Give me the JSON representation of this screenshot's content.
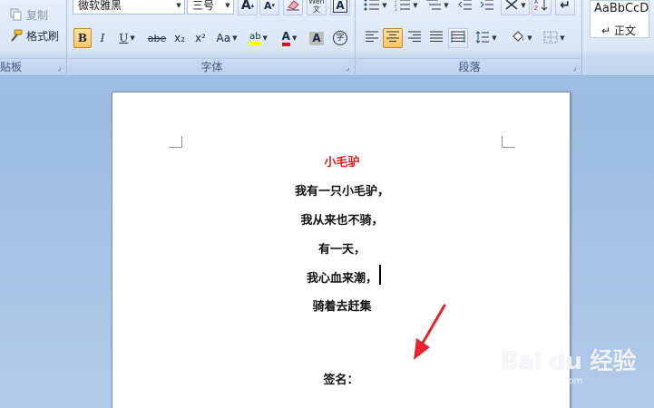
{
  "ribbon": {
    "clipboard": {
      "copy_label": "复制",
      "format_painter_label": "格式刷",
      "group_label": "贴板"
    },
    "font": {
      "font_name": "微软雅黑",
      "font_size": "三号",
      "grow_font": "A",
      "shrink_font": "A",
      "bold": "B",
      "italic": "I",
      "underline": "U",
      "strikethrough": "abe",
      "subscript": "x₂",
      "superscript": "x²",
      "change_case": "Aa",
      "highlight": "ab",
      "font_color": "A",
      "char_shading": "A",
      "enclose": "字",
      "phonetic": "Wén 文",
      "group_label": "字体"
    },
    "paragraph": {
      "group_label": "段落"
    },
    "styles": {
      "sample": "AaBbCcD",
      "style_name": "↵ 正文"
    }
  },
  "document": {
    "title": "小毛驴",
    "lines": [
      "我有一只小毛驴，",
      "我从来也不骑，",
      "有一天，",
      "我心血来潮，",
      "骑着去赶集"
    ],
    "signature": "签名："
  },
  "watermark": {
    "logo": "Bai du 经验",
    "url": "jingyan.baidu.com"
  },
  "colors": {
    "title_red": "#e02020",
    "annotation_red": "#e8232e",
    "ribbon_blue": "#c0d5ef"
  }
}
